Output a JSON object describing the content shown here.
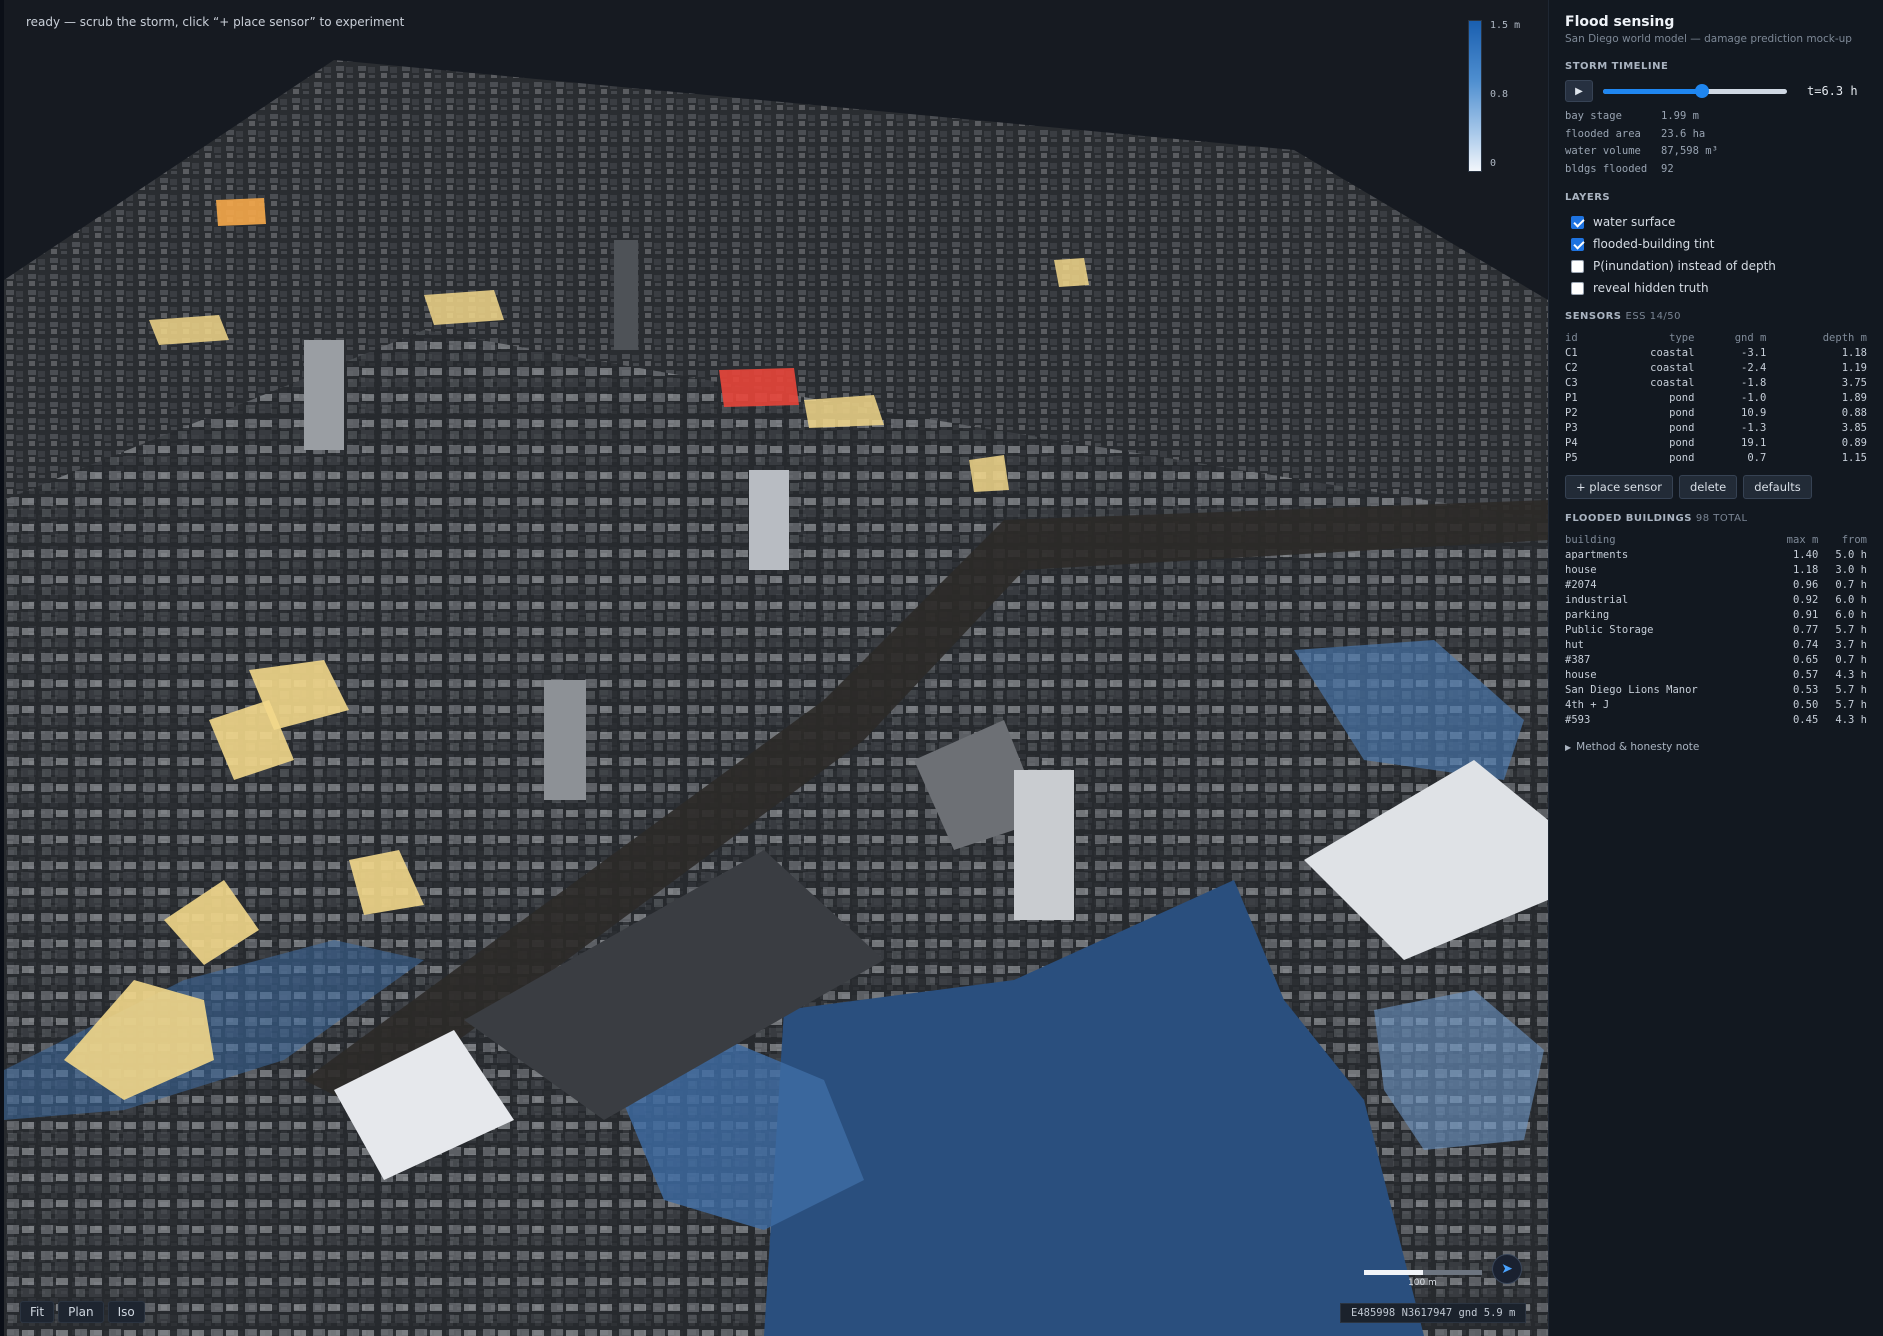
{
  "status": "ready — scrub the storm, click “+ place sensor” to experiment",
  "legend": {
    "max": "1.5 m",
    "mid": "0.8",
    "min": "0"
  },
  "view_buttons": [
    "Fit",
    "Plan",
    "Iso"
  ],
  "scale_label": "100 m",
  "coords": "E485998 N3617947 gnd 5.9 m",
  "panel": {
    "title": "Flood sensing",
    "subtitle": "San Diego world model — damage prediction mock-up",
    "storm": {
      "heading": "STORM TIMELINE",
      "progress": 0.54,
      "time_label": "t=6.3 h",
      "stats": [
        {
          "k": "bay stage",
          "v": "1.99 m"
        },
        {
          "k": "flooded area",
          "v": "23.6 ha"
        },
        {
          "k": "water volume",
          "v": "87,598 m³"
        },
        {
          "k": "bldgs flooded",
          "v": "92"
        }
      ]
    },
    "layers": {
      "heading": "LAYERS",
      "items": [
        {
          "label": "water surface",
          "checked": true
        },
        {
          "label": "flooded-building tint",
          "checked": true
        },
        {
          "label": "P(inundation) instead of depth",
          "checked": false
        },
        {
          "label": "reveal hidden truth",
          "checked": false
        }
      ]
    },
    "sensors": {
      "heading": "SENSORS",
      "sub": "ESS 14/50",
      "columns": [
        "id",
        "type",
        "gnd m",
        "depth m"
      ],
      "rows": [
        [
          "C1",
          "coastal",
          "-3.1",
          "1.18"
        ],
        [
          "C2",
          "coastal",
          "-2.4",
          "1.19"
        ],
        [
          "C3",
          "coastal",
          "-1.8",
          "3.75"
        ],
        [
          "P1",
          "pond",
          "-1.0",
          "1.89"
        ],
        [
          "P2",
          "pond",
          "10.9",
          "0.88"
        ],
        [
          "P3",
          "pond",
          "-1.3",
          "3.85"
        ],
        [
          "P4",
          "pond",
          "19.1",
          "0.89"
        ],
        [
          "P5",
          "pond",
          "0.7",
          "1.15"
        ]
      ],
      "buttons": {
        "place": "+ place sensor",
        "delete": "delete",
        "defaults": "defaults"
      }
    },
    "flooded": {
      "heading": "FLOODED BUILDINGS",
      "sub": "98 TOTAL",
      "columns": [
        "building",
        "max m",
        "from"
      ],
      "rows": [
        [
          "apartments",
          "1.40",
          "5.0 h"
        ],
        [
          "house",
          "1.18",
          "3.0 h"
        ],
        [
          "#2074",
          "0.96",
          "0.7 h"
        ],
        [
          "industrial",
          "0.92",
          "6.0 h"
        ],
        [
          "parking",
          "0.91",
          "6.0 h"
        ],
        [
          "Public Storage",
          "0.77",
          "5.7 h"
        ],
        [
          "hut",
          "0.74",
          "3.7 h"
        ],
        [
          "#387",
          "0.65",
          "0.7 h"
        ],
        [
          "house",
          "0.57",
          "4.3 h"
        ],
        [
          "San Diego Lions Manor",
          "0.53",
          "5.7 h"
        ],
        [
          "4th + J",
          "0.50",
          "5.7 h"
        ],
        [
          "#593",
          "0.45",
          "4.3 h"
        ]
      ]
    },
    "method_label": "Method & honesty note"
  },
  "colors": {
    "accent": "#1f86f0",
    "water": "#2a4f7e",
    "flood_tint": "#f2d78a",
    "hot": "#e8453a"
  }
}
